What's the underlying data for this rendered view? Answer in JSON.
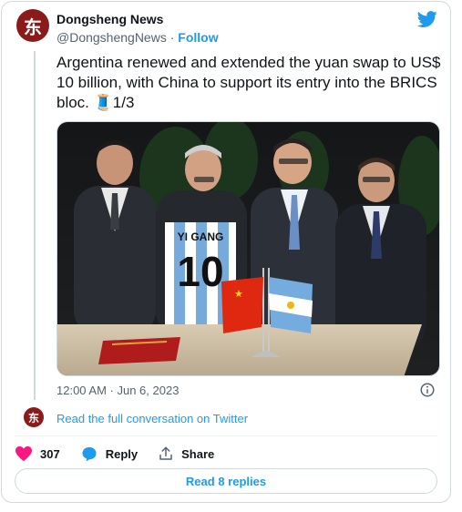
{
  "account": {
    "display_name": "Dongsheng News",
    "handle": "@DongshengNews",
    "separator": "·",
    "follow_label": "Follow",
    "avatar_glyph": "东"
  },
  "tweet": {
    "text": "Argentina renewed and extended the yuan swap to US$ 10 billion, with China to support its entry into the BRICS bloc. 🧵1/3",
    "timestamp": "12:00 AM · Jun 6, 2023"
  },
  "media": {
    "jersey_name": "YI GANG",
    "jersey_number": "10"
  },
  "conversation": {
    "read_full_label": "Read the full conversation on Twitter"
  },
  "actions": {
    "like_count": "307",
    "reply_label": "Reply",
    "share_label": "Share"
  },
  "footer": {
    "read_replies_label": "Read 8 replies"
  },
  "colors": {
    "accent": "#1d9bf0",
    "like": "#f91880",
    "avatar_bg": "#8b1a1a"
  }
}
